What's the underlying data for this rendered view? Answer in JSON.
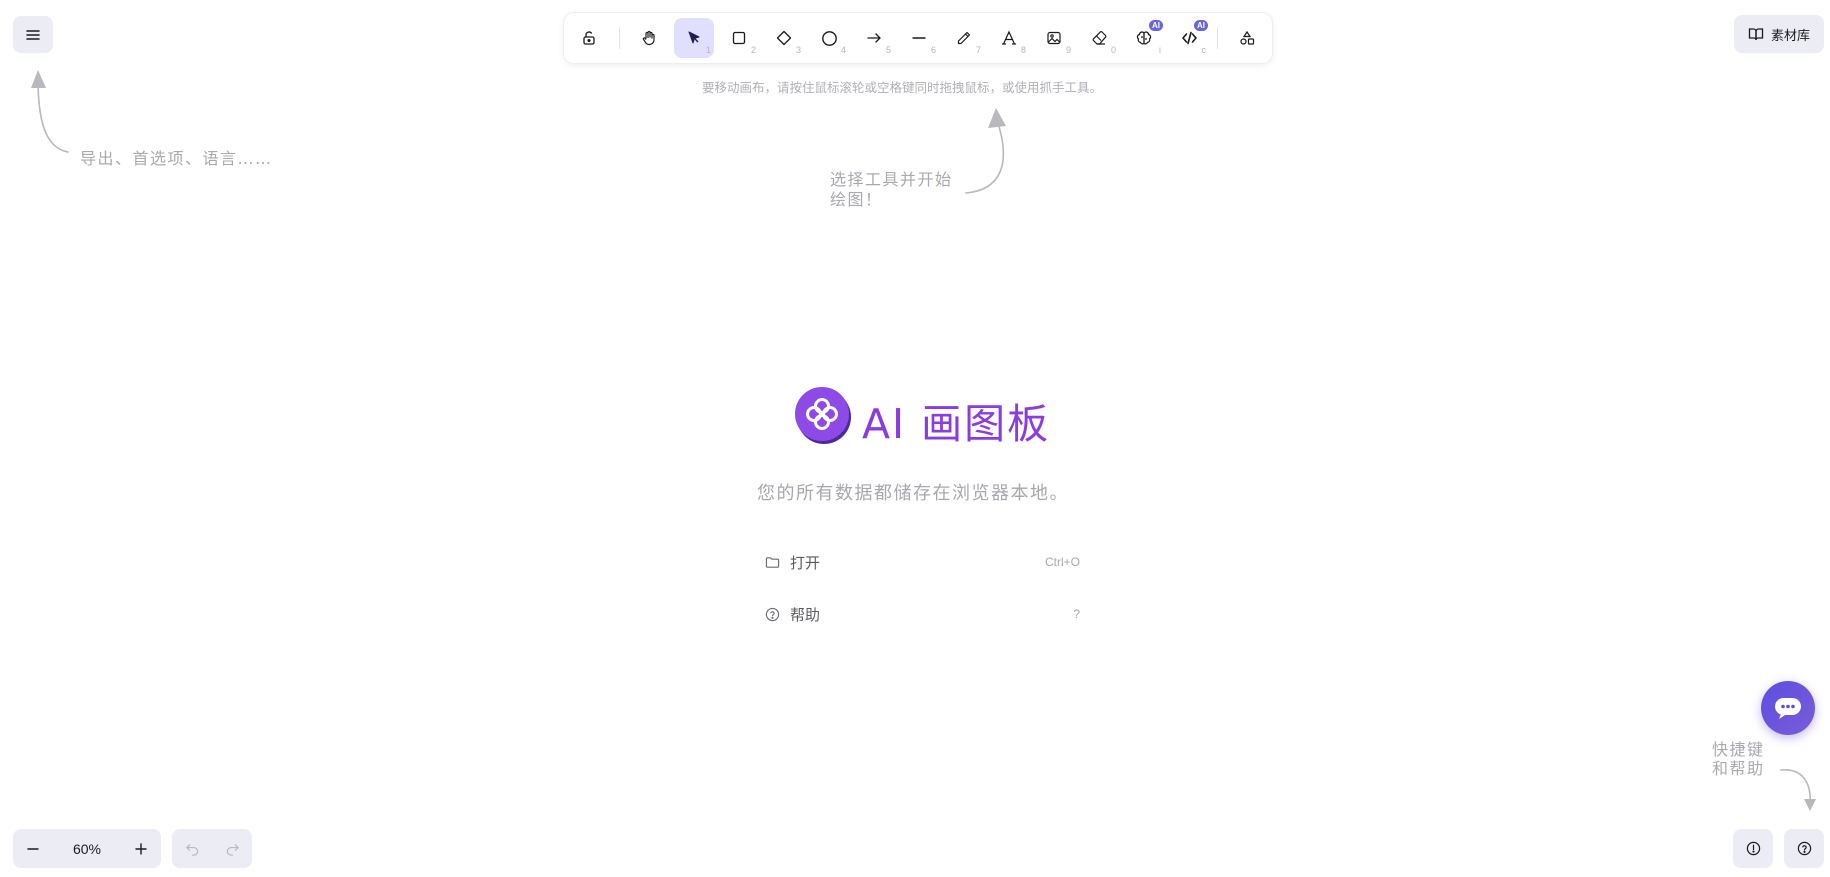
{
  "header": {
    "menu_icon": "hamburger-icon",
    "library_label": "素材库"
  },
  "toolbar": {
    "tools": [
      {
        "name": "lock",
        "icon": "unlock-icon",
        "key": ""
      },
      {
        "name": "hand",
        "icon": "hand-icon",
        "key": ""
      },
      {
        "name": "selection",
        "icon": "cursor-icon",
        "key": "1",
        "selected": true
      },
      {
        "name": "rectangle",
        "icon": "square-icon",
        "key": "2"
      },
      {
        "name": "diamond",
        "icon": "diamond-icon",
        "key": "3"
      },
      {
        "name": "ellipse",
        "icon": "circle-icon",
        "key": "4"
      },
      {
        "name": "arrow",
        "icon": "arrow-icon",
        "key": "5"
      },
      {
        "name": "line",
        "icon": "line-icon",
        "key": "6"
      },
      {
        "name": "draw",
        "icon": "pencil-icon",
        "key": "7"
      },
      {
        "name": "text",
        "icon": "text-icon",
        "key": "8"
      },
      {
        "name": "image",
        "icon": "image-icon",
        "key": "9"
      },
      {
        "name": "eraser",
        "icon": "eraser-icon",
        "key": "0"
      },
      {
        "name": "ai-brain",
        "icon": "brain-icon",
        "key": "i",
        "badge": "AI"
      },
      {
        "name": "ai-code",
        "icon": "code-icon",
        "key": "c",
        "badge": "AI"
      },
      {
        "name": "shapes",
        "icon": "shapes-icon",
        "key": ""
      }
    ]
  },
  "hints": {
    "canvas": "要移动画布，请按住鼠标滚轮或空格键同时拖拽鼠标，或使用抓手工具。",
    "menu": "导出、首选项、语言……",
    "tool_line1": "选择工具并开始",
    "tool_line2": "绘图！",
    "help_line1": "快捷键",
    "help_line2": "和帮助"
  },
  "welcome": {
    "logo_icon": "clover-logo-icon",
    "title": "AI 画图板",
    "subtitle": "您的所有数据都储存在浏览器本地。",
    "items": [
      {
        "icon": "folder-icon",
        "label": "打开",
        "shortcut": "Ctrl+O"
      },
      {
        "icon": "help-circle-icon",
        "label": "帮助",
        "shortcut": "?"
      }
    ]
  },
  "footer": {
    "zoom_out_icon": "minus-icon",
    "zoom_level": "60%",
    "zoom_in_icon": "plus-icon",
    "undo_icon": "undo-icon",
    "redo_icon": "redo-icon",
    "info_icon": "info-icon",
    "help_icon": "question-icon"
  },
  "chat": {
    "icon": "chat-bot-icon"
  },
  "colors": {
    "accent": "#6965db",
    "selected_bg": "#e0dfff",
    "brand_purple": "#8b3ce0",
    "button_bg": "#ececf4",
    "hint_gray": "#b0b0b6"
  }
}
